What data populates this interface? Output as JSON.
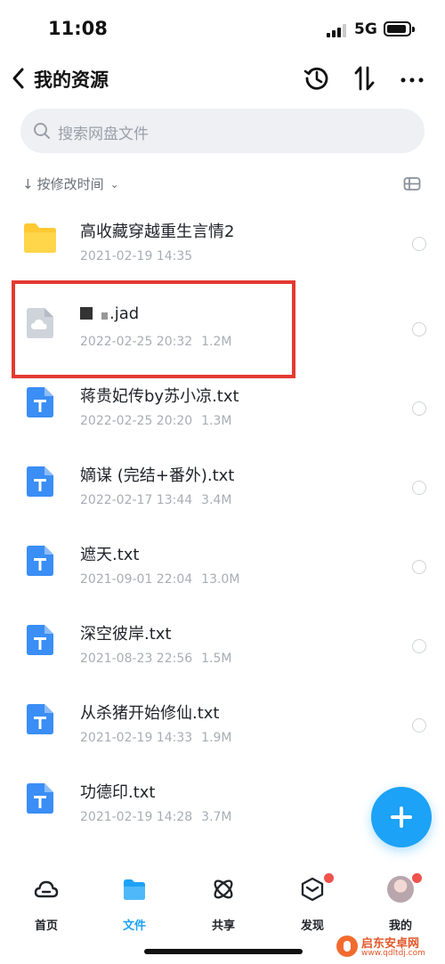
{
  "status_bar": {
    "time": "11:08",
    "network": "5G"
  },
  "header": {
    "title": "我的资源"
  },
  "search": {
    "placeholder": "搜索网盘文件"
  },
  "sort": {
    "label": "按修改时间"
  },
  "files": [
    {
      "name": "高收藏穿越重生言情2",
      "date": "2021-02-19 14:35",
      "size": "",
      "icon": "folder-icon"
    },
    {
      "name": ".jad",
      "date": "2022-02-25 20:32",
      "size": "1.2M",
      "icon": "cloud-file-icon"
    },
    {
      "name": "蒋贵妃传by苏小凉.txt",
      "date": "2022-02-25 20:20",
      "size": "1.3M",
      "icon": "txt-file-icon"
    },
    {
      "name": "嫡谋 (完结+番外).txt",
      "date": "2022-02-17 13:44",
      "size": "3.4M",
      "icon": "txt-file-icon"
    },
    {
      "name": "遮天.txt",
      "date": "2021-09-01 22:04",
      "size": "13.0M",
      "icon": "txt-file-icon"
    },
    {
      "name": "深空彼岸.txt",
      "date": "2021-08-23 22:56",
      "size": "1.5M",
      "icon": "txt-file-icon"
    },
    {
      "name": "从杀猪开始修仙.txt",
      "date": "2021-02-19 14:33",
      "size": "1.9M",
      "icon": "txt-file-icon"
    },
    {
      "name": "功德印.txt",
      "date": "2021-02-19 14:28",
      "size": "3.7M",
      "icon": "txt-file-icon"
    }
  ],
  "nav": [
    {
      "label": "首页",
      "icon": "home-cloud-icon",
      "active": false,
      "badge": false
    },
    {
      "label": "文件",
      "icon": "folder-tab-icon",
      "active": true,
      "badge": false
    },
    {
      "label": "共享",
      "icon": "share-atom-icon",
      "active": false,
      "badge": false
    },
    {
      "label": "发现",
      "icon": "discover-box-icon",
      "active": false,
      "badge": true
    },
    {
      "label": "我的",
      "icon": "avatar",
      "active": false,
      "badge": true
    }
  ],
  "watermark": {
    "text": "启东安卓网",
    "url": "www.qdltdj.com"
  },
  "colors": {
    "accent": "#1ca2f6",
    "highlight": "#e33a32",
    "badge": "#f0524c",
    "folder": "#ffc933",
    "txt": "#3a8ef5"
  }
}
